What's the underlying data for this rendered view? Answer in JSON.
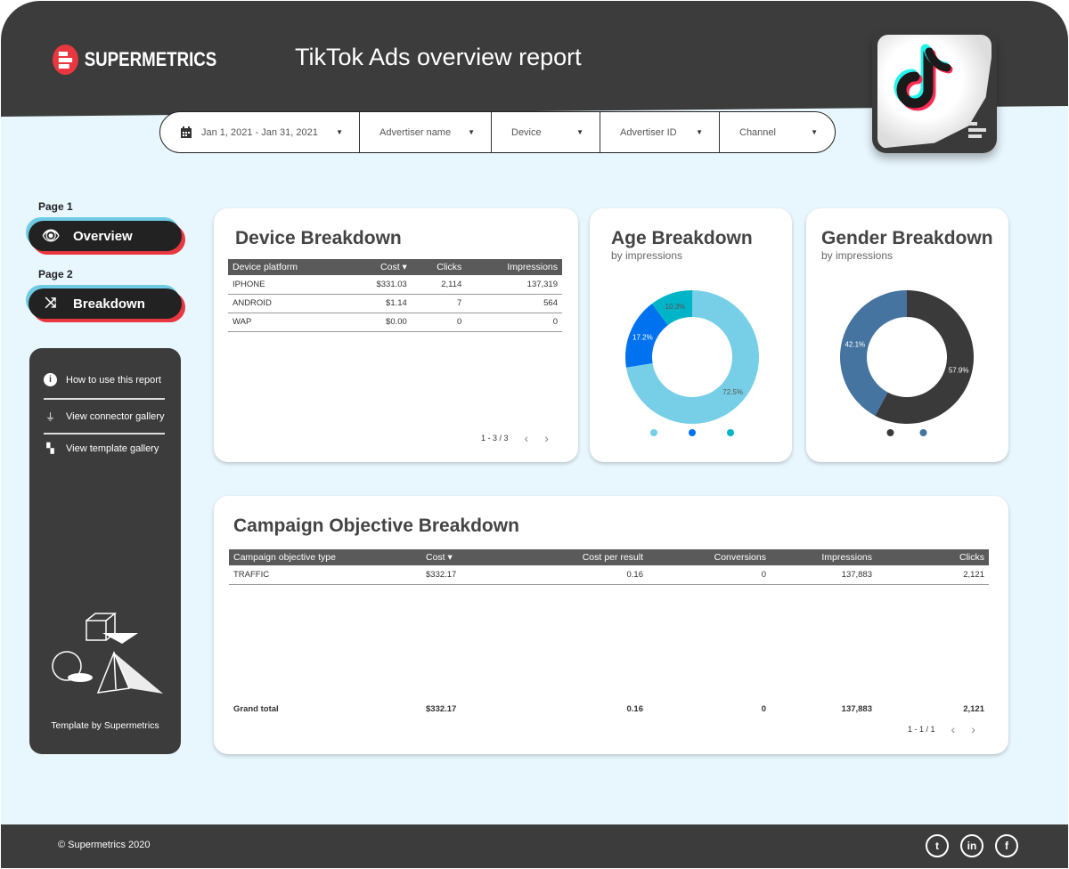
{
  "header": {
    "brand": "SUPERMETRICS",
    "title": "TikTok Ads overview report"
  },
  "filters": [
    {
      "label": "Jan 1, 2021 - Jan 31, 2021",
      "icon": "calendar-icon"
    },
    {
      "label": "Advertiser name"
    },
    {
      "label": "Device"
    },
    {
      "label": "Advertiser ID"
    },
    {
      "label": "Channel"
    }
  ],
  "nav": {
    "page1_label": "Page 1",
    "page1_button": "Overview",
    "page2_label": "Page 2",
    "page2_button": "Breakdown"
  },
  "panel": {
    "items": [
      "How to use this report",
      "View connector gallery",
      "View template gallery"
    ],
    "credit": "Template by Supermetrics"
  },
  "device": {
    "title": "Device Breakdown",
    "columns": [
      "Device platform",
      "Cost",
      "Clicks",
      "Impressions"
    ],
    "rows": [
      [
        "IPHONE",
        "$331.03",
        "2,114",
        "137,319"
      ],
      [
        "ANDROID",
        "$1.14",
        "7",
        "564"
      ],
      [
        "WAP",
        "$0.00",
        "0",
        "0"
      ]
    ],
    "pagination": "1 - 3 / 3"
  },
  "age": {
    "title": "Age Breakdown",
    "subtitle": "by impressions"
  },
  "gender": {
    "title": "Gender Breakdown",
    "subtitle": "by impressions"
  },
  "chart_data": [
    {
      "type": "pie",
      "title": "Age Breakdown",
      "subtitle": "by impressions",
      "donut": true,
      "values": [
        72.5,
        17.2,
        10.3
      ],
      "labels": [
        "72.5%",
        "17.2%",
        "10.3%"
      ],
      "colors": [
        "#76cfe6",
        "#0072f0",
        "#00b4c8"
      ],
      "legend": "bottom"
    },
    {
      "type": "pie",
      "title": "Gender Breakdown",
      "subtitle": "by impressions",
      "donut": true,
      "values": [
        57.9,
        42.1
      ],
      "labels": [
        "57.9%",
        "42.1%"
      ],
      "colors": [
        "#3a3a3a",
        "#4674a0"
      ],
      "legend": "bottom"
    }
  ],
  "campaign": {
    "title": "Campaign Objective Breakdown",
    "columns": [
      "Campaign objective type",
      "Cost",
      "Cost per result",
      "Conversions",
      "Impressions",
      "Clicks"
    ],
    "rows": [
      [
        "TRAFFIC",
        "$332.17",
        "0.16",
        "0",
        "137,883",
        "2,121"
      ]
    ],
    "total": [
      "Grand total",
      "$332.17",
      "0.16",
      "0",
      "137,883",
      "2,121"
    ],
    "pagination": "1 - 1 / 1"
  },
  "footer": {
    "copyright": "© Supermetrics 2020",
    "social": [
      "twitter-icon",
      "linkedin-icon",
      "facebook-icon"
    ]
  }
}
